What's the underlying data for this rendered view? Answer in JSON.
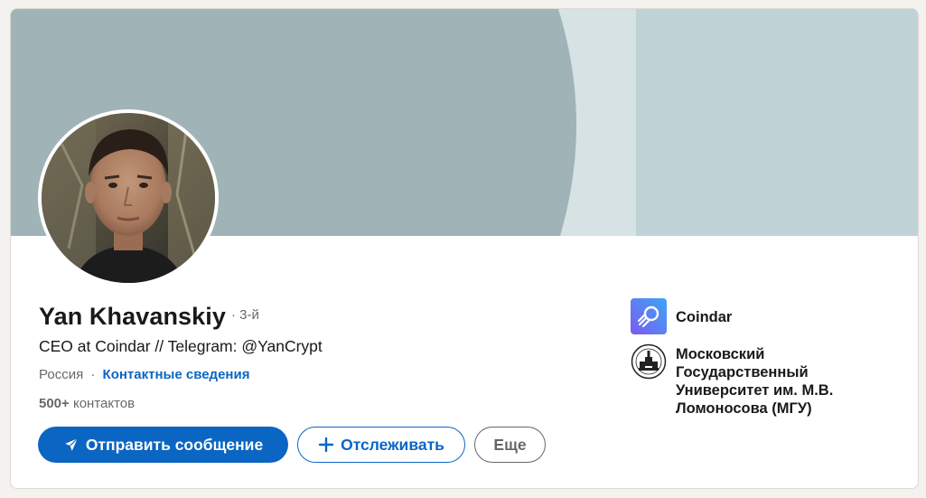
{
  "profile": {
    "name": "Yan Khavanskiy",
    "degree": "· 3-й",
    "headline": "CEO at Coindar // Telegram: @YanCrypt",
    "location": "Россия",
    "separator": "·",
    "contact_link": "Контактные сведения",
    "connections_count": "500+",
    "connections_label": "контактов"
  },
  "actions": {
    "message_label": "Отправить сообщение",
    "follow_label": "Отслеживать",
    "more_label": "Еще"
  },
  "organizations": [
    {
      "name": "Coindar",
      "logo": "coindar-logo-icon"
    },
    {
      "name": "Московский Государственный Университет им. М.В. Ломоносова (МГУ)",
      "logo": "msu-logo-icon"
    }
  ],
  "icons": {
    "message": "send-icon",
    "follow": "plus-icon"
  },
  "colors": {
    "accent": "#0a66c2",
    "banner_dark": "#a0b4b7",
    "banner_light": "#d6e2e4",
    "banner_right": "#bfd3d6"
  }
}
